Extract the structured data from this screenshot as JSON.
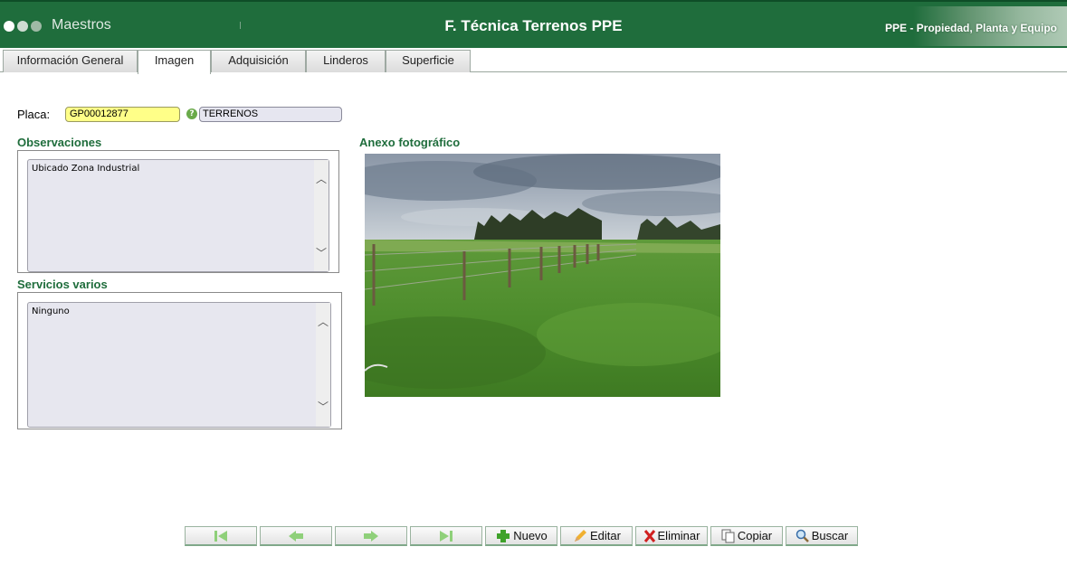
{
  "header": {
    "app_name": "Maestros",
    "form_title": "F. Técnica Terrenos PPE",
    "module_title": "PPE - Propiedad, Planta y Equipo",
    "dot_colors": [
      "#ffffff",
      "#cfdcd2",
      "#9fbaa6"
    ]
  },
  "tabs": [
    {
      "label": "Información General",
      "active": false
    },
    {
      "label": "Imagen",
      "active": true
    },
    {
      "label": "Adquisición",
      "active": false
    },
    {
      "label": "Linderos",
      "active": false
    },
    {
      "label": "Superficie",
      "active": false
    }
  ],
  "form": {
    "placa_label": "Placa:",
    "placa_value": "GP00012877",
    "placa_description": "TERRENOS",
    "observaciones_title": "Observaciones",
    "observaciones_text": "Ubicado Zona Industrial",
    "servicios_title": "Servicios varios",
    "servicios_text": "Ninguno",
    "anexo_title": "Anexo fotográfico"
  },
  "toolbar": {
    "first_icon": "first-record-icon",
    "prev_icon": "previous-record-icon",
    "next_icon": "next-record-icon",
    "last_icon": "last-record-icon",
    "nuevo_label": "Nuevo",
    "editar_label": "Editar",
    "eliminar_label": "Eliminar",
    "copiar_label": "Copiar",
    "buscar_label": "Buscar"
  },
  "colors": {
    "header_green": "#1f6d3c",
    "section_title": "#1f6d3c",
    "placa_bg": "#ffff88"
  }
}
